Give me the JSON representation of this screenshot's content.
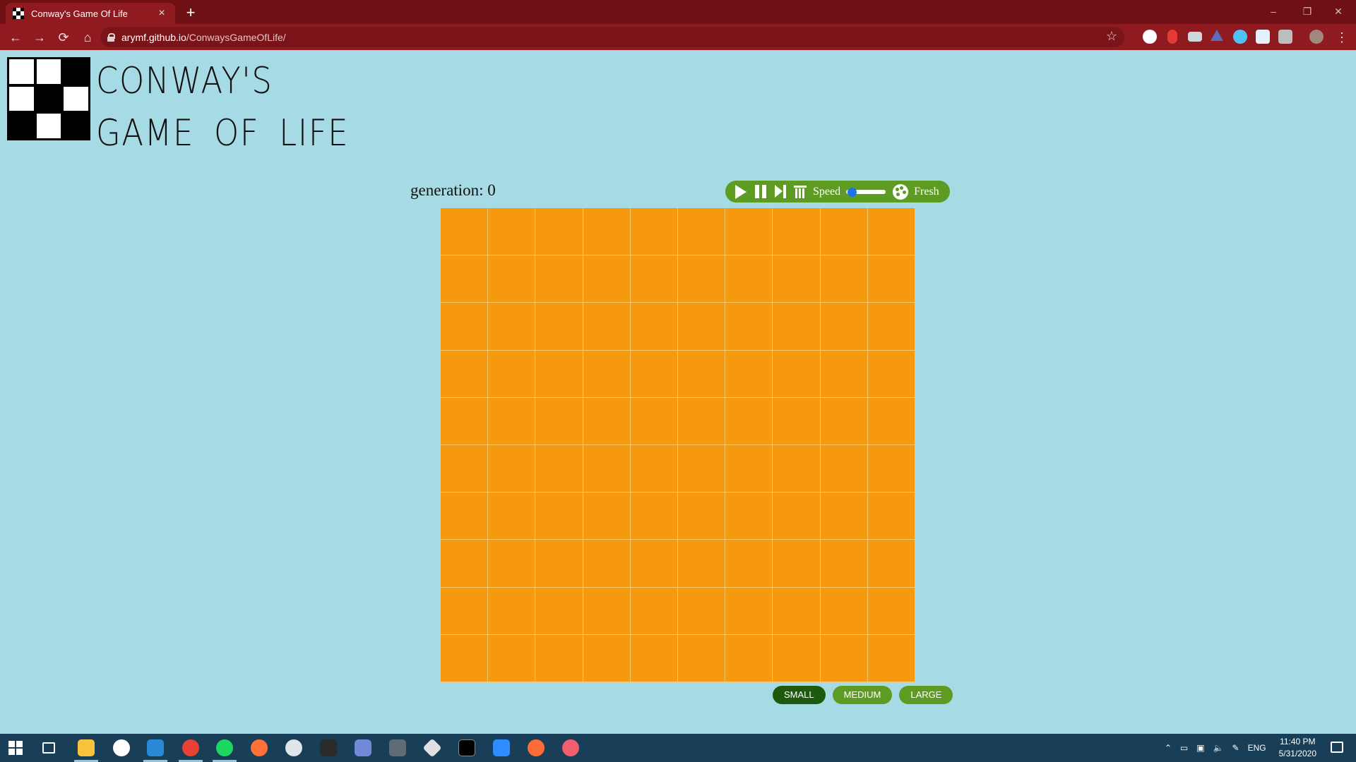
{
  "browser": {
    "tab_title": "Conway's Game Of Life",
    "tab_close": "×",
    "new_tab": "+",
    "url_host": "arymf.github.io",
    "url_path": "/ConwaysGameOfLife/",
    "back": "←",
    "forward": "→",
    "reload": "⟳",
    "home": "⌂",
    "bookmark": "☆",
    "minimize": "–",
    "restore": "❐",
    "close": "✕",
    "menu": "⋮"
  },
  "page": {
    "title_line1": "CONWAY'S",
    "title_line2": "GAME OF LIFE",
    "generation_label": "generation: 0"
  },
  "controls": {
    "speed_label": "Speed",
    "speed_value": 0.05,
    "theme_label": "Fresh",
    "icons": [
      "play-icon",
      "pause-icon",
      "step-icon",
      "trash-icon",
      "palette-icon"
    ]
  },
  "board": {
    "rows": 10,
    "cols": 10,
    "cell_color": "#f7990f",
    "grid_color": "#f9c76a"
  },
  "sizes": {
    "small": "SMALL",
    "medium": "MEDIUM",
    "large": "LARGE",
    "selected": "SMALL"
  },
  "colors": {
    "background": "#a6dae4",
    "accent_green": "#5d9b23",
    "selected_green": "#1d5a0d",
    "chrome_red": "#8f1b20"
  },
  "taskbar": {
    "language": "ENG",
    "time": "11:40 PM",
    "date": "5/31/2020"
  }
}
